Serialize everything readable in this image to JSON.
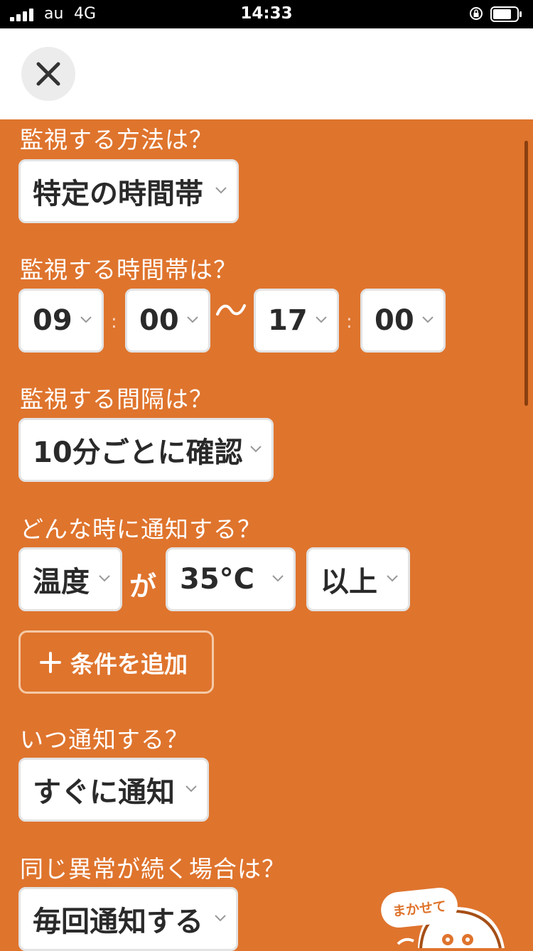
{
  "status_bar": {
    "carrier": "au",
    "network": "4G",
    "time": "14:33"
  },
  "questions": {
    "method": "監視する方法は？",
    "timeslot": "監視する時間帯は？",
    "interval": "監視する間隔は？",
    "when_notify": "どんな時に通知する？",
    "timing": "いつ通知する？",
    "repeat": "同じ異常が続く場合は？"
  },
  "selects": {
    "method": "特定の時間帯",
    "start_hour": "09",
    "start_minute": "00",
    "end_hour": "17",
    "end_minute": "00",
    "interval": "10分ごとに確認",
    "metric": "温度",
    "threshold": "35°C",
    "comparison": "以上",
    "timing": "すぐに通知",
    "repeat": "毎回通知する"
  },
  "labels": {
    "colon": ":",
    "ga": "が",
    "add_condition": "条件を追加"
  },
  "mascot": {
    "bubble_text": "まかせて"
  },
  "colors": {
    "accent": "#df742d",
    "select_bg": "#ffffff",
    "text": "#2a2a2a"
  },
  "icons": [
    "close-icon",
    "chevron-down-icon",
    "plus-icon",
    "tilde-icon"
  ]
}
